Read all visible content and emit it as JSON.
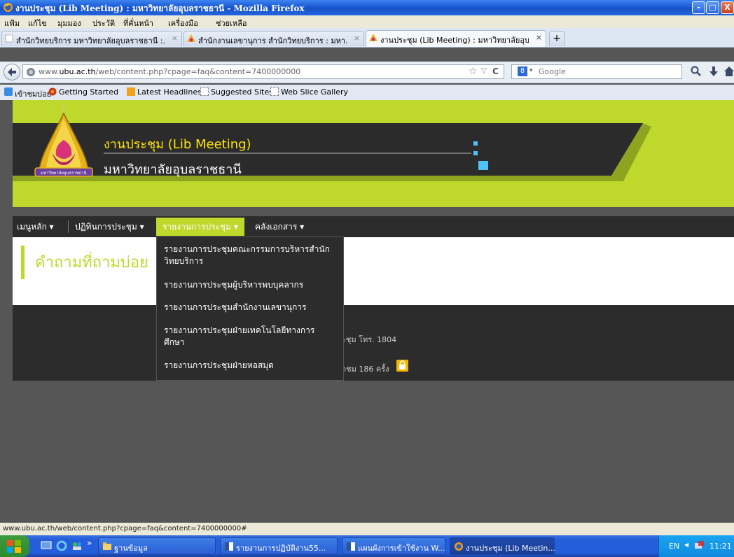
{
  "window": {
    "title": "งานประชุม (Lib Meeting) : มหาวิทยาลัยอุบลราชธานี - Mozilla Firefox",
    "controls": [
      "-",
      "□",
      "X"
    ]
  },
  "menubar": [
    "แฟ้ม",
    "แก้ไข",
    "มุมมอง",
    "ประวัติ",
    "ที่คั่นหน้า",
    "เครื่องมือ",
    "ช่วยเหลือ"
  ],
  "tabs": [
    {
      "label": "สำนักวิทยบริการ มหาวิทยาลัยอุบลราชธานี :..."
    },
    {
      "label": "สำนักงานเลขานุการ สำนักวิทยบริการ : มหา..."
    },
    {
      "label": "งานประชุม (Lib Meeting) : มหาวิทยาลัยอุบ..."
    }
  ],
  "tab_close": "×",
  "new_tab": "+",
  "navbar": {
    "url_prefix": "www.",
    "url_domain": "ubu.ac.th",
    "url_path": "/web/content.php?cpage=faq&content=7400000000",
    "search_engine": "Google",
    "star": "☆",
    "dropmark": "▽",
    "reload": "C"
  },
  "bookmarks": [
    "เข้าชมบ่อย",
    "Getting Started",
    "Latest Headlines",
    "Suggested Sites",
    "Web Slice Gallery"
  ],
  "site": {
    "title_th": "งานประชุม (Lib Meeting)",
    "university": "มหาวิทยาลัยอุบลราชธานี",
    "logo_text": "มหาวิทยาลัยอุบลราชธานี",
    "accent_color": "#bed82b",
    "nav": [
      {
        "label": "เมนูหลัก ▾"
      },
      {
        "label": "ปฏิทินการประชุม ▾"
      },
      {
        "label": "รายงานการประชุม ▾"
      },
      {
        "label": "คลังเอกสาร ▾"
      }
    ],
    "dropdown": [
      "รายงานการประชุมคณะกรรมการบริหารสำนัก\nวิทยบริการ",
      "รายงานการประชุมผู้บริหารพบบุคลากร",
      "รายงานการประชุมสำนักงานเลขานุการ",
      "รายงานการประชุมฝ่ายเทคโนโลยีทางการ\nศึกษา",
      "รายงานการประชุมฝ่ายหอสมุด"
    ],
    "page_heading": "คำถามที่ถามบ่อย",
    "footer_phone": "ะชุม  โทร. 1804",
    "footer_visits": "าชม 186 ครั้ง"
  },
  "status_url": "www.ubu.ac.th/web/content.php?cpage=faq&content=7400000000#",
  "taskbar": {
    "expand": "»",
    "buttons": [
      {
        "label": "ฐานข้อมูล"
      },
      {
        "label": "รายงานการปฏิบัติงาน55..."
      },
      {
        "label": "แผนผังการเข้าใช้งาน W..."
      },
      {
        "label": "งานประชุม (Lib Meetin..."
      }
    ],
    "lang": "EN",
    "time": "11:21"
  }
}
